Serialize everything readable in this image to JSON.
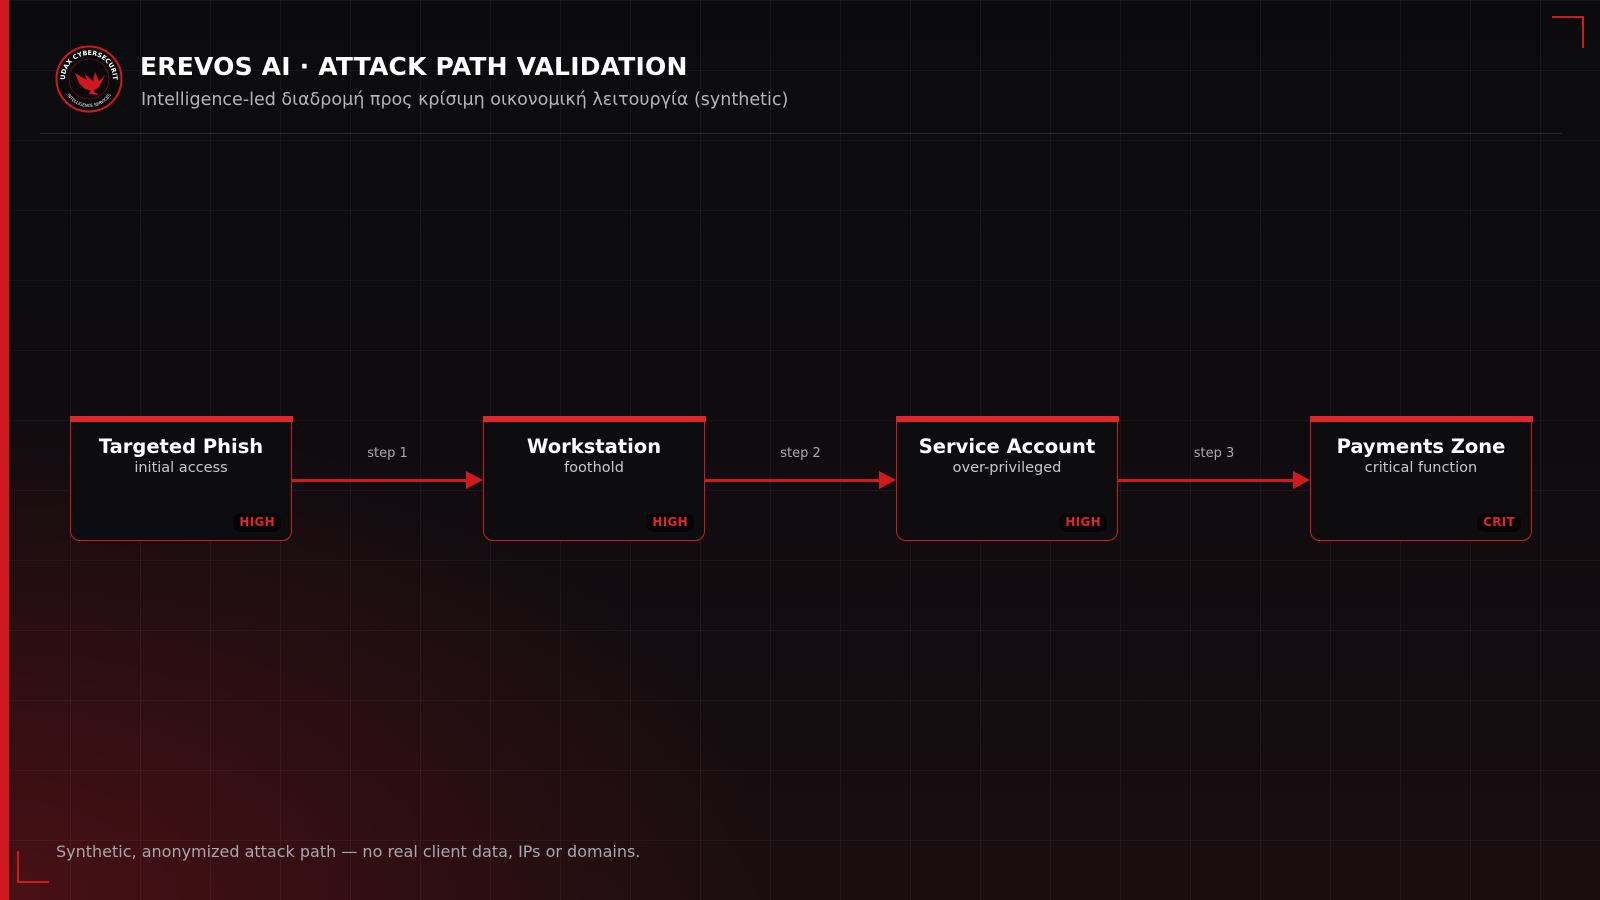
{
  "header": {
    "title": "EREVOS AI · ATTACK PATH VALIDATION",
    "subtitle": "Intelligence-led διαδρομή προς κρίσιμη οικονομική λειτουργία (synthetic)",
    "logo": {
      "ring_text_top": "AUDAX CYBERSECURITY",
      "ring_text_bottom": "INTELLIGENCE SERVICES",
      "icon": "eagle-icon"
    }
  },
  "attack_path": {
    "nodes": [
      {
        "name": "Targeted Phish",
        "role": "initial access",
        "severity": "HIGH"
      },
      {
        "name": "Workstation",
        "role": "foothold",
        "severity": "HIGH"
      },
      {
        "name": "Service Account",
        "role": "over-privileged",
        "severity": "HIGH"
      },
      {
        "name": "Payments Zone",
        "role": "critical function",
        "severity": "CRIT"
      }
    ],
    "edges": [
      {
        "label": "step 1"
      },
      {
        "label": "step 2"
      },
      {
        "label": "step 3"
      }
    ]
  },
  "footer": {
    "note": "Synthetic, anonymized attack path — no real client data, IPs or domains."
  },
  "colors": {
    "accent": "#d0191e",
    "background": "#0b0b0e",
    "node_fill": "#0d0d10",
    "text_muted": "#b4b4ba"
  }
}
